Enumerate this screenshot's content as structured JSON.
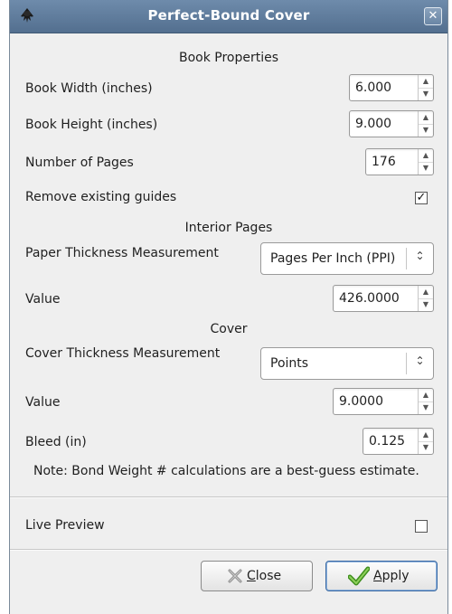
{
  "window": {
    "title": "Perfect-Bound Cover",
    "app_icon": "inkscape-icon",
    "close_icon": "close-icon"
  },
  "book_properties": {
    "heading": "Book Properties",
    "width_label": "Book Width (inches)",
    "width_value": "6.000",
    "height_label": "Book Height (inches)",
    "height_value": "9.000",
    "pages_label": "Number of Pages",
    "pages_value": "176",
    "remove_guides_label": "Remove existing guides",
    "remove_guides_checked": true
  },
  "interior_pages": {
    "heading": "Interior Pages",
    "measurement_label": "Paper Thickness Measurement",
    "measurement_value": "Pages Per Inch (PPI)",
    "value_label": "Value",
    "value": "426.0000"
  },
  "cover": {
    "heading": "Cover",
    "measurement_label": "Cover Thickness Measurement",
    "measurement_value": "Points",
    "value_label": "Value",
    "value": "9.0000",
    "bleed_label": "Bleed (in)",
    "bleed_value": "0.125"
  },
  "note": "Note: Bond Weight # calculations are a best-guess estimate.",
  "live_preview": {
    "label": "Live Preview",
    "checked": false
  },
  "buttons": {
    "close_label_accel": "C",
    "close_label_rest": "lose",
    "close_icon": "close-x-icon",
    "apply_label_accel": "A",
    "apply_label_rest": "pply",
    "apply_icon": "checkmark-icon"
  }
}
